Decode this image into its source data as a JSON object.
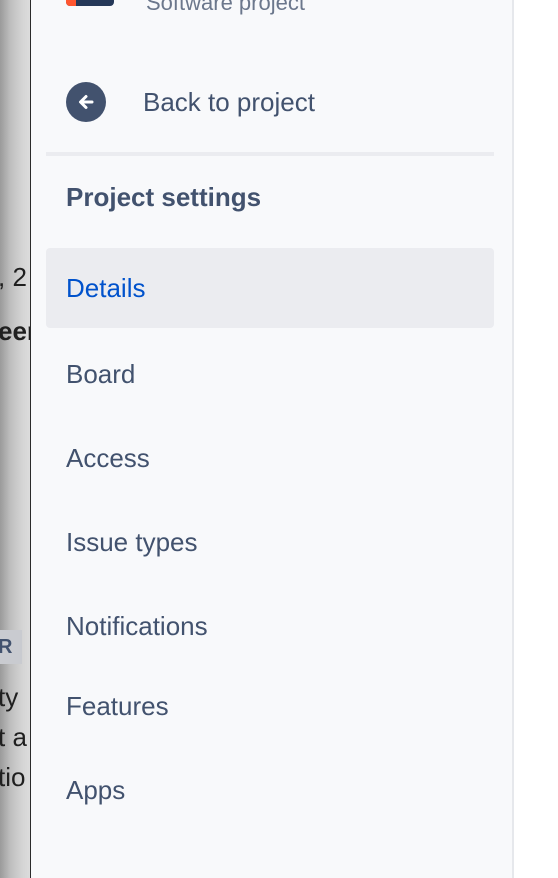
{
  "background": {
    "fragments": [
      ", 2",
      "eer",
      "ty",
      "t a",
      "tio"
    ],
    "badge": "R"
  },
  "sidebar": {
    "project_type": "Software project",
    "back_label": "Back to project",
    "section_title": "Project settings",
    "items": [
      {
        "label": "Details",
        "active": true
      },
      {
        "label": "Board",
        "active": false
      },
      {
        "label": "Access",
        "active": false
      },
      {
        "label": "Issue types",
        "active": false
      },
      {
        "label": "Notifications",
        "active": false
      },
      {
        "label": "Features",
        "active": false
      },
      {
        "label": "Apps",
        "active": false
      }
    ]
  },
  "colors": {
    "active_text": "#0052cc",
    "text": "#42526e",
    "active_bg": "#ebecf0",
    "sidebar_bg": "#f8f9fb"
  },
  "icons": {
    "back": "arrow-left-circle-icon",
    "project": "project-avatar-icon"
  }
}
